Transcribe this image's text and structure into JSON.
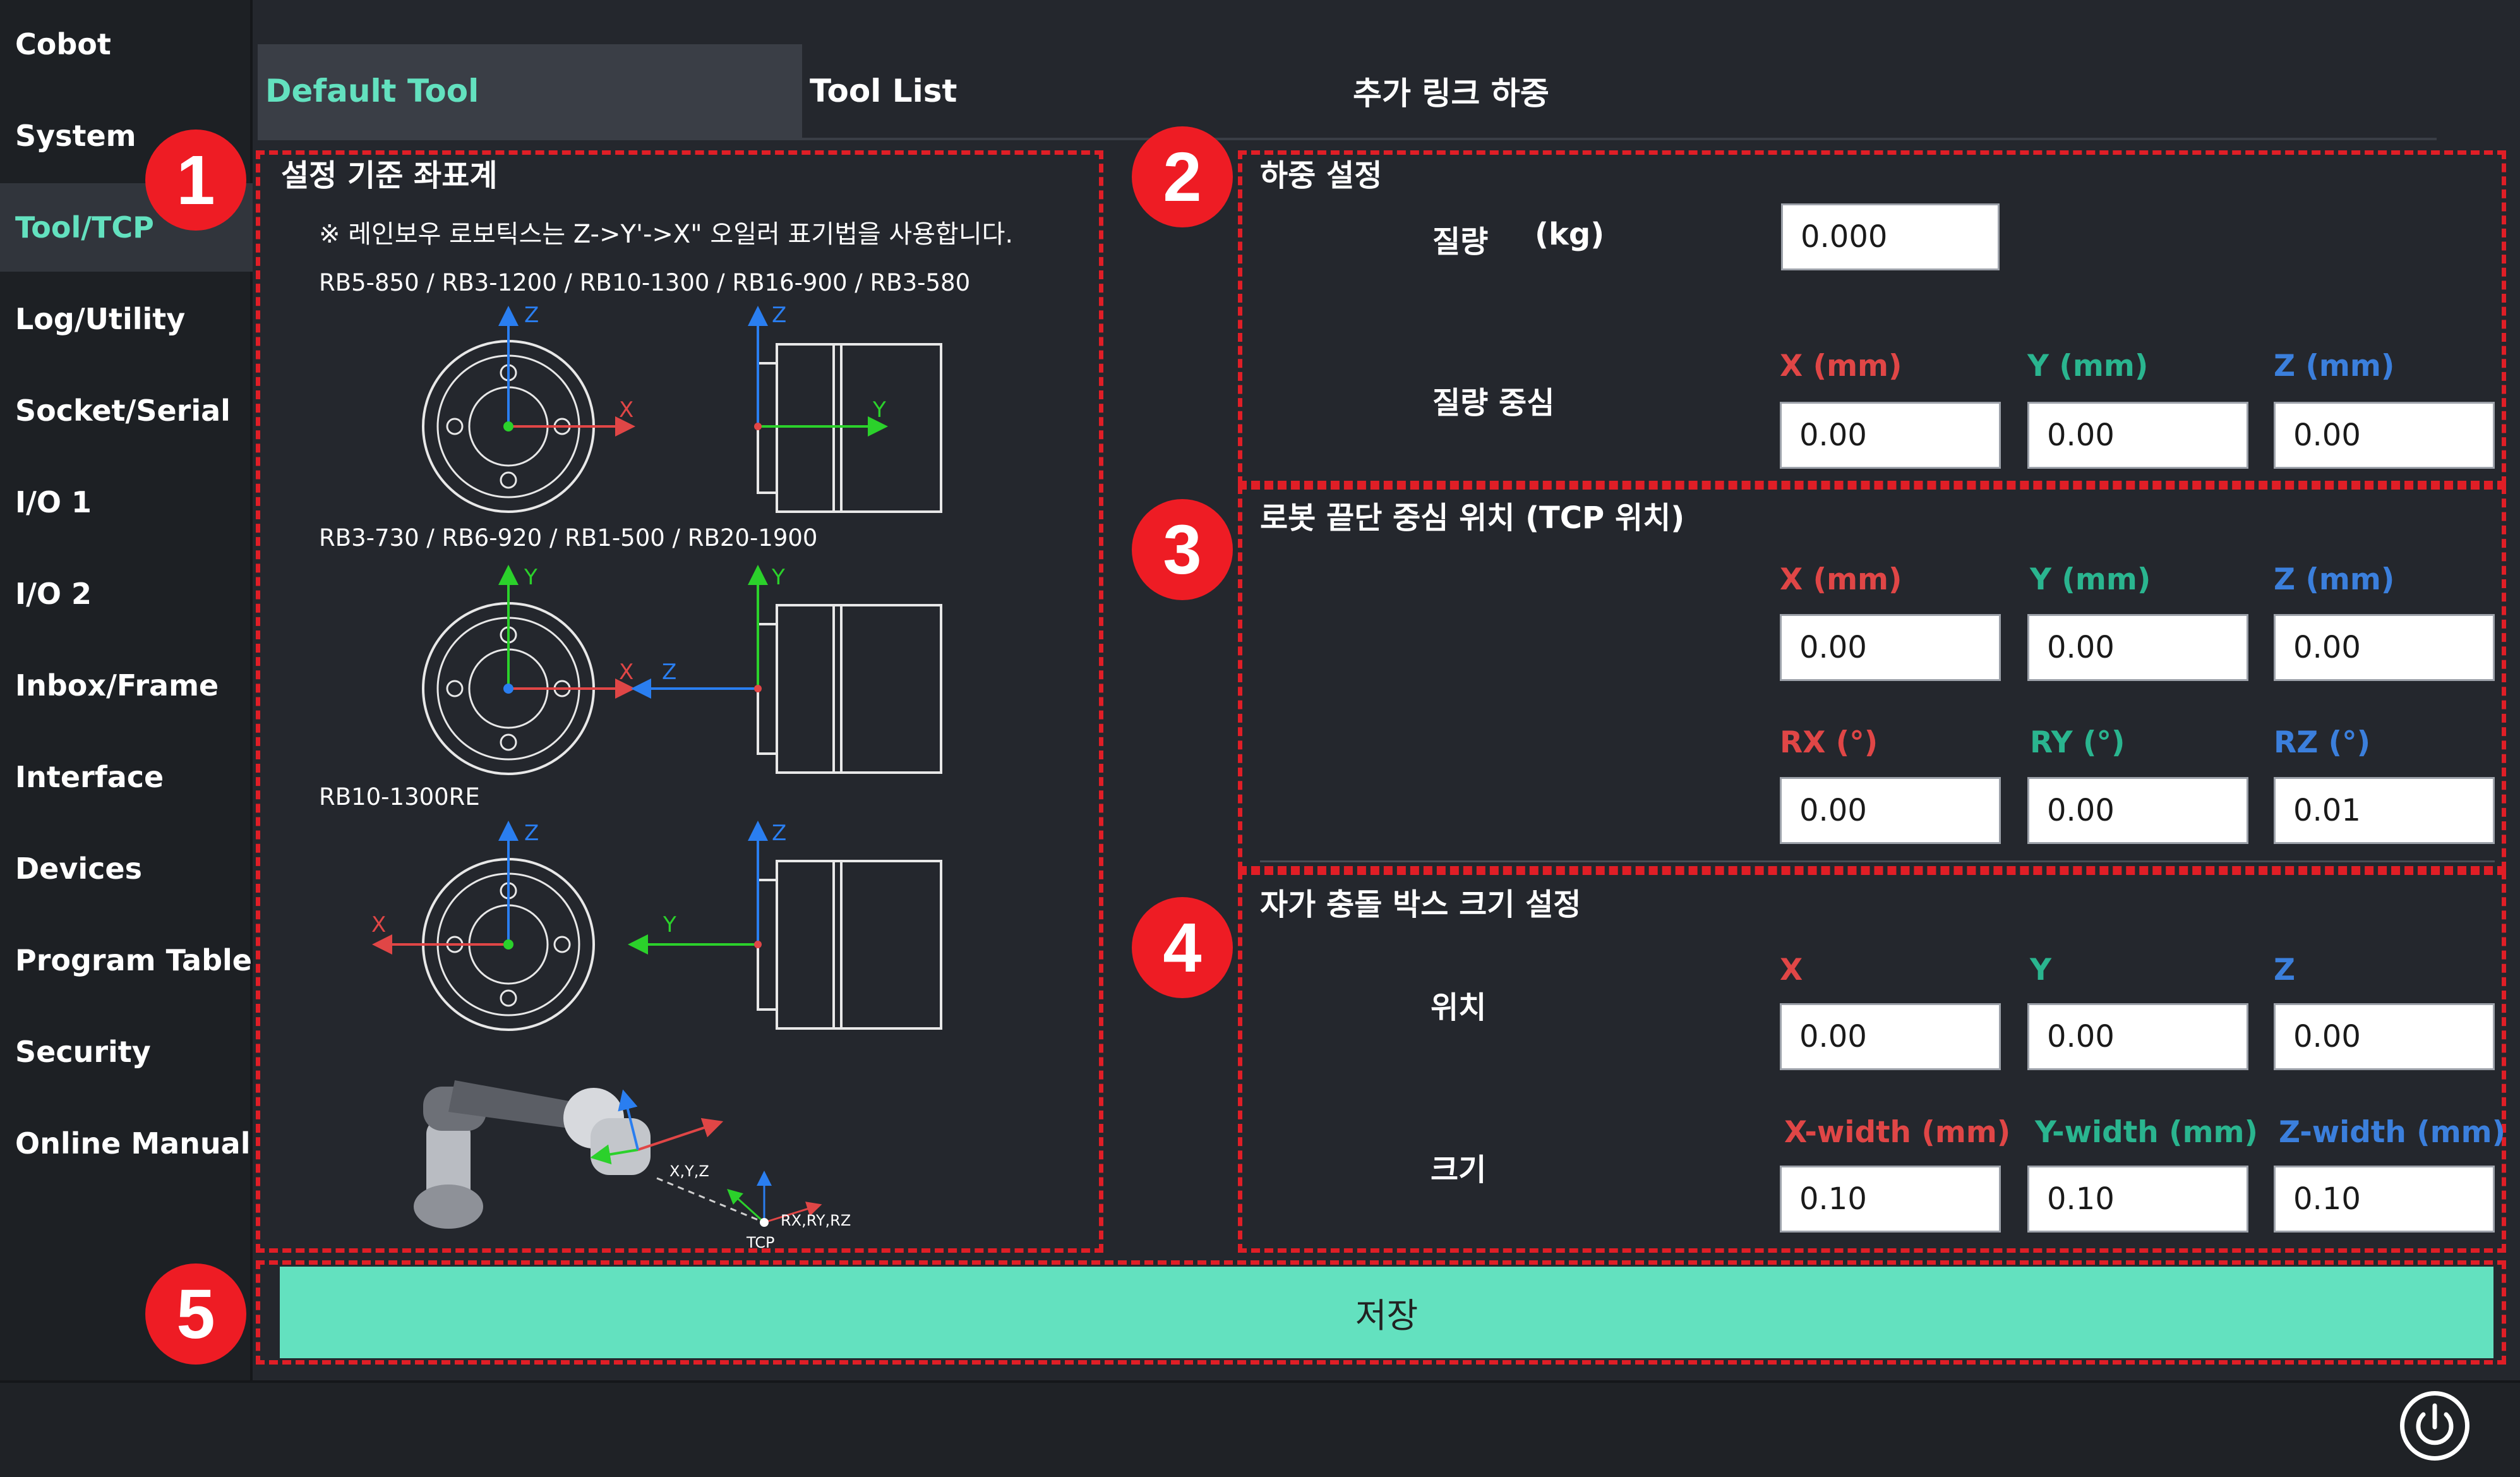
{
  "sidebar": {
    "items": [
      {
        "label": "Cobot"
      },
      {
        "label": "System"
      },
      {
        "label": "Tool/TCP"
      },
      {
        "label": "Log/Utility"
      },
      {
        "label": "Socket/Serial"
      },
      {
        "label": "I/O 1"
      },
      {
        "label": "I/O 2"
      },
      {
        "label": "Inbox/Frame"
      },
      {
        "label": "Interface"
      },
      {
        "label": "Devices"
      },
      {
        "label": "Program Table"
      },
      {
        "label": "Security"
      },
      {
        "label": "Online Manual"
      }
    ],
    "active": "Tool/TCP"
  },
  "tabs": {
    "default_tool": "Default Tool",
    "tool_list": "Tool List",
    "extra_link": "추가 링크 하중"
  },
  "badges": [
    "1",
    "2",
    "3",
    "4",
    "5"
  ],
  "reference_frame": {
    "title": "설정 기준 좌표계",
    "note": "※ 레인보우 로보틱스는 Z->Y'->X\" 오일러 표기법을 사용합니다.",
    "groups": [
      {
        "models": "RB5-850 / RB3-1200 / RB10-1300 / RB16-900 / RB3-580"
      },
      {
        "models": "RB3-730 / RB6-920 / RB1-500 / RB20-1900"
      },
      {
        "models": "RB10-1300RE"
      }
    ],
    "axis_letters": {
      "x": "X",
      "y": "Y",
      "z": "Z"
    },
    "robot_labels": {
      "xyz": "X,Y,Z",
      "rxryrz": "RX,RY,RZ",
      "tcp": "TCP"
    }
  },
  "load": {
    "title": "하중 설정",
    "mass_label": "질량",
    "mass_unit": "(kg)",
    "mass_value": "0.000",
    "center_label": "질량 중심",
    "headers": [
      "X (mm)",
      "Y (mm)",
      "Z (mm)"
    ],
    "center_values": [
      "0.00",
      "0.00",
      "0.00"
    ]
  },
  "tcp": {
    "title": "로봇 끝단 중심 위치 (TCP 위치)",
    "pos_headers": [
      "X (mm)",
      "Y (mm)",
      "Z (mm)"
    ],
    "pos_values": [
      "0.00",
      "0.00",
      "0.00"
    ],
    "rot_headers": [
      "RX (°)",
      "RY (°)",
      "RZ (°)"
    ],
    "rot_values": [
      "0.00",
      "0.00",
      "0.01"
    ]
  },
  "collision_box": {
    "title": "자가 충돌 박스 크기 설정",
    "position_label": "위치",
    "position_headers": [
      "X",
      "Y",
      "Z"
    ],
    "position_values": [
      "0.00",
      "0.00",
      "0.00"
    ],
    "size_label": "크기",
    "size_headers": [
      "X-width (mm)",
      "Y-width (mm)",
      "Z-width (mm)"
    ],
    "size_values": [
      "0.10",
      "0.10",
      "0.10"
    ]
  },
  "save_label": "저장",
  "colors": {
    "accent": "#63e1bf",
    "highlight_dash": "#e01e26",
    "badge": "#ee1c24",
    "axis_x": "#e04646",
    "axis_y": "#2ab58f",
    "axis_z": "#3b7fdc"
  },
  "icons": {
    "power": "power-icon"
  }
}
